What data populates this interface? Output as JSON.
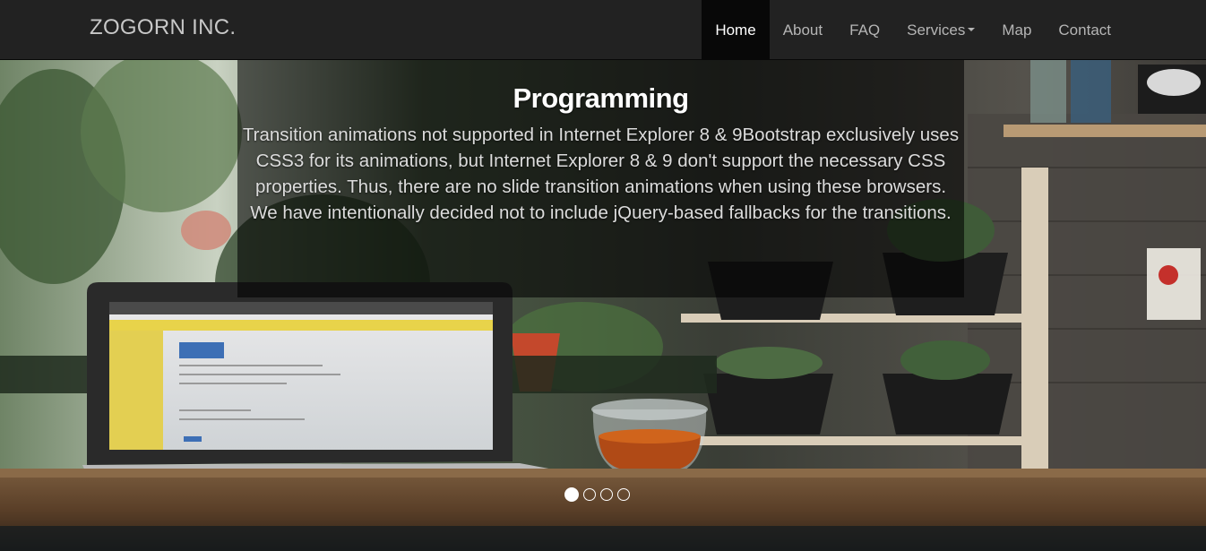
{
  "navbar": {
    "brand": "ZOGORN INC.",
    "items": [
      {
        "label": "Home",
        "active": true
      },
      {
        "label": "About"
      },
      {
        "label": "FAQ"
      },
      {
        "label": "Services",
        "dropdown": true
      },
      {
        "label": "Map"
      },
      {
        "label": "Contact"
      }
    ]
  },
  "carousel": {
    "slide_image": "laptop-and-plants-desk-photo",
    "caption": {
      "title": "Programming",
      "text": "Transition animations not supported in Internet Explorer 8 & 9Bootstrap exclusively uses CSS3 for its animations, but Internet Explorer 8 & 9 don't support the necessary CSS properties. Thus, there are no slide transition animations when using these browsers. We have intentionally decided not to include jQuery-based fallbacks for the transitions."
    },
    "indicators": {
      "count": 4,
      "active": 1
    }
  },
  "colors": {
    "navbar_bg": "#222222",
    "nav_active_bg": "#080808",
    "nav_text": "#b5b5b5"
  }
}
